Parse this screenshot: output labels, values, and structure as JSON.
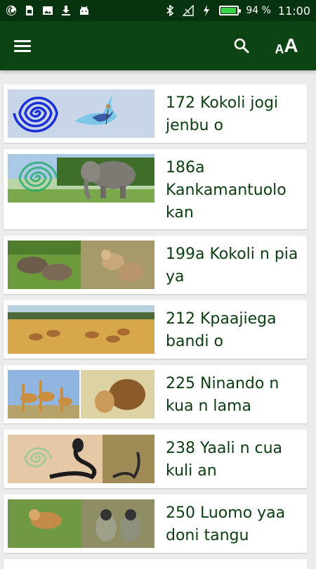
{
  "status_bar": {
    "battery_percent": "94 %",
    "time": "11:00",
    "battery_level": 0.94,
    "icons": [
      "app-logo-icon",
      "sim-card-icon",
      "image-icon",
      "download-icon",
      "android-icon",
      "bluetooth-icon",
      "signal-icon",
      "charging-icon",
      "battery-icon"
    ]
  },
  "app_bar": {
    "menu_icon": "menu-icon",
    "search_icon": "search-icon",
    "font_size_label_small": "A",
    "font_size_label_big": "A"
  },
  "colors": {
    "app_bar": "#0d4413",
    "status_bar": "#07330f",
    "title_text": "#0b3d11",
    "background": "#ececec"
  },
  "stories": [
    {
      "title": "172 Kokoli jogi jenbu o",
      "image": "spiral-and-roller-bird"
    },
    {
      "title": "186a Kankamantuolo kan",
      "image": "spiral-and-elephant"
    },
    {
      "title": "199a Kokoli n pia ya",
      "image": "warthogs-and-baboons"
    },
    {
      "title": "212 Kpaajiega bandi o",
      "image": "antelopes-on-savanna"
    },
    {
      "title": "225 Ninando n kua n lama",
      "image": "giraffes-and-lions"
    },
    {
      "title": "238 Yaali n cua kuli an",
      "image": "spiral-and-cobras"
    },
    {
      "title": "250 Luomo yaa doni tangu",
      "image": "monkeys"
    }
  ]
}
